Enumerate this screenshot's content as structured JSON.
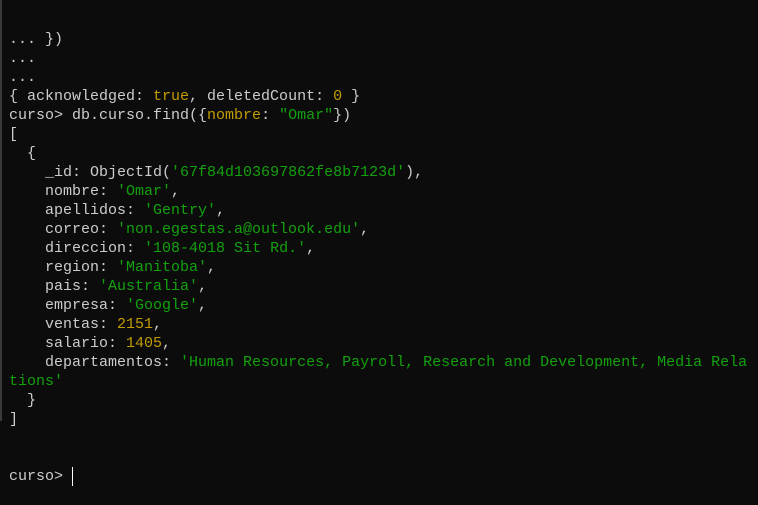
{
  "colors": {
    "background": "#0c0c0c",
    "text": "#cccccc",
    "string": "#13a10e",
    "number": "#c19c00"
  },
  "terminal": {
    "lines": [
      [
        {
          "t": "... })",
          "c": "k"
        }
      ],
      [
        {
          "t": "...",
          "c": "k"
        }
      ],
      [
        {
          "t": "...",
          "c": "k"
        }
      ],
      [
        {
          "t": "{ acknowledged: ",
          "c": "k"
        },
        {
          "t": "true",
          "c": "n"
        },
        {
          "t": ", deletedCount: ",
          "c": "k"
        },
        {
          "t": "0",
          "c": "n"
        },
        {
          "t": " }",
          "c": "k"
        }
      ],
      [
        {
          "t": "curso> db.curso.find({",
          "c": "k"
        },
        {
          "t": "nombre",
          "c": "n"
        },
        {
          "t": ": ",
          "c": "k"
        },
        {
          "t": "\"Omar\"",
          "c": "s"
        },
        {
          "t": "})",
          "c": "k"
        }
      ],
      [
        {
          "t": "[",
          "c": "k"
        }
      ],
      [
        {
          "t": "  {",
          "c": "k"
        }
      ],
      [
        {
          "t": "    _id: ObjectId(",
          "c": "k"
        },
        {
          "t": "'67f84d103697862fe8b7123d'",
          "c": "s"
        },
        {
          "t": "),",
          "c": "k"
        }
      ],
      [
        {
          "t": "    nombre: ",
          "c": "k"
        },
        {
          "t": "'Omar'",
          "c": "s"
        },
        {
          "t": ",",
          "c": "k"
        }
      ],
      [
        {
          "t": "    apellidos: ",
          "c": "k"
        },
        {
          "t": "'Gentry'",
          "c": "s"
        },
        {
          "t": ",",
          "c": "k"
        }
      ],
      [
        {
          "t": "    correo: ",
          "c": "k"
        },
        {
          "t": "'non.egestas.a@outlook.edu'",
          "c": "s"
        },
        {
          "t": ",",
          "c": "k"
        }
      ],
      [
        {
          "t": "    direccion: ",
          "c": "k"
        },
        {
          "t": "'108-4018 Sit Rd.'",
          "c": "s"
        },
        {
          "t": ",",
          "c": "k"
        }
      ],
      [
        {
          "t": "    region: ",
          "c": "k"
        },
        {
          "t": "'Manitoba'",
          "c": "s"
        },
        {
          "t": ",",
          "c": "k"
        }
      ],
      [
        {
          "t": "    pais: ",
          "c": "k"
        },
        {
          "t": "'Australia'",
          "c": "s"
        },
        {
          "t": ",",
          "c": "k"
        }
      ],
      [
        {
          "t": "    empresa: ",
          "c": "k"
        },
        {
          "t": "'Google'",
          "c": "s"
        },
        {
          "t": ",",
          "c": "k"
        }
      ],
      [
        {
          "t": "    ventas: ",
          "c": "k"
        },
        {
          "t": "2151",
          "c": "n"
        },
        {
          "t": ",",
          "c": "k"
        }
      ],
      [
        {
          "t": "    salario: ",
          "c": "k"
        },
        {
          "t": "1405",
          "c": "n"
        },
        {
          "t": ",",
          "c": "k"
        }
      ],
      [
        {
          "t": "    departamentos: ",
          "c": "k"
        },
        {
          "t": "'Human Resources, Payroll, Research and Development, Media Rela",
          "c": "s"
        }
      ],
      [
        {
          "t": "tions'",
          "c": "s"
        }
      ],
      [
        {
          "t": "  }",
          "c": "k"
        }
      ],
      [
        {
          "t": "]",
          "c": "k"
        }
      ]
    ],
    "prompt": "curso>"
  }
}
